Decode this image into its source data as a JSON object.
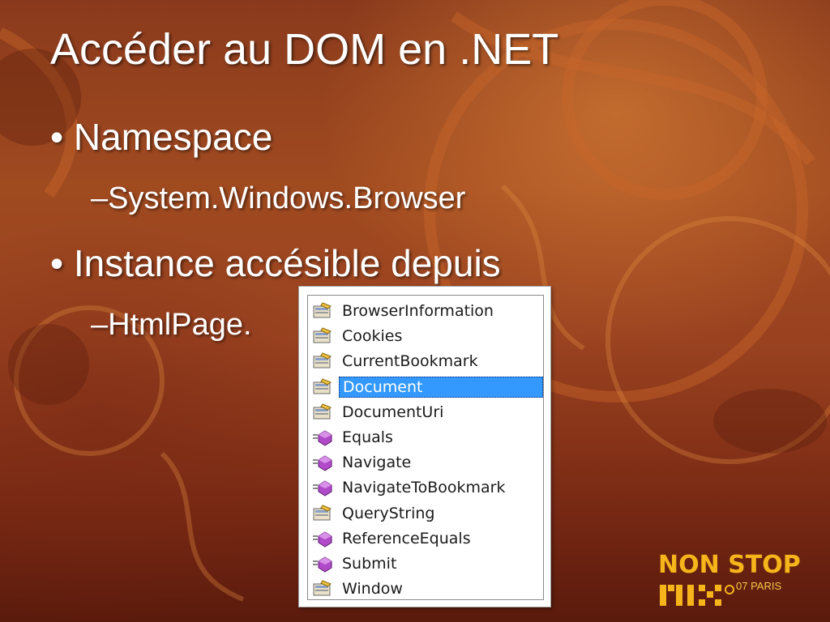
{
  "slide": {
    "title": "Accéder au DOM en .NET",
    "bullets": [
      {
        "text": "• Namespace",
        "sub": "–System.Windows.Browser"
      },
      {
        "text": "• Instance accésible depuis",
        "sub": "–HtmlPage."
      }
    ]
  },
  "intellisense": {
    "selected": "Document",
    "items": [
      {
        "label": "BrowserInformation",
        "icon": "property-icon"
      },
      {
        "label": "Cookies",
        "icon": "property-icon"
      },
      {
        "label": "CurrentBookmark",
        "icon": "property-icon"
      },
      {
        "label": "Document",
        "icon": "property-icon"
      },
      {
        "label": "DocumentUri",
        "icon": "property-icon"
      },
      {
        "label": "Equals",
        "icon": "method-icon"
      },
      {
        "label": "Navigate",
        "icon": "method-icon"
      },
      {
        "label": "NavigateToBookmark",
        "icon": "method-icon"
      },
      {
        "label": "QueryString",
        "icon": "property-icon"
      },
      {
        "label": "ReferenceEquals",
        "icon": "method-icon"
      },
      {
        "label": "Submit",
        "icon": "method-icon"
      },
      {
        "label": "Window",
        "icon": "property-icon"
      }
    ]
  },
  "logo": {
    "line1": "NON STOP",
    "line2": "07 PARIS",
    "mark": "MIX",
    "color": "#f6b51a"
  }
}
